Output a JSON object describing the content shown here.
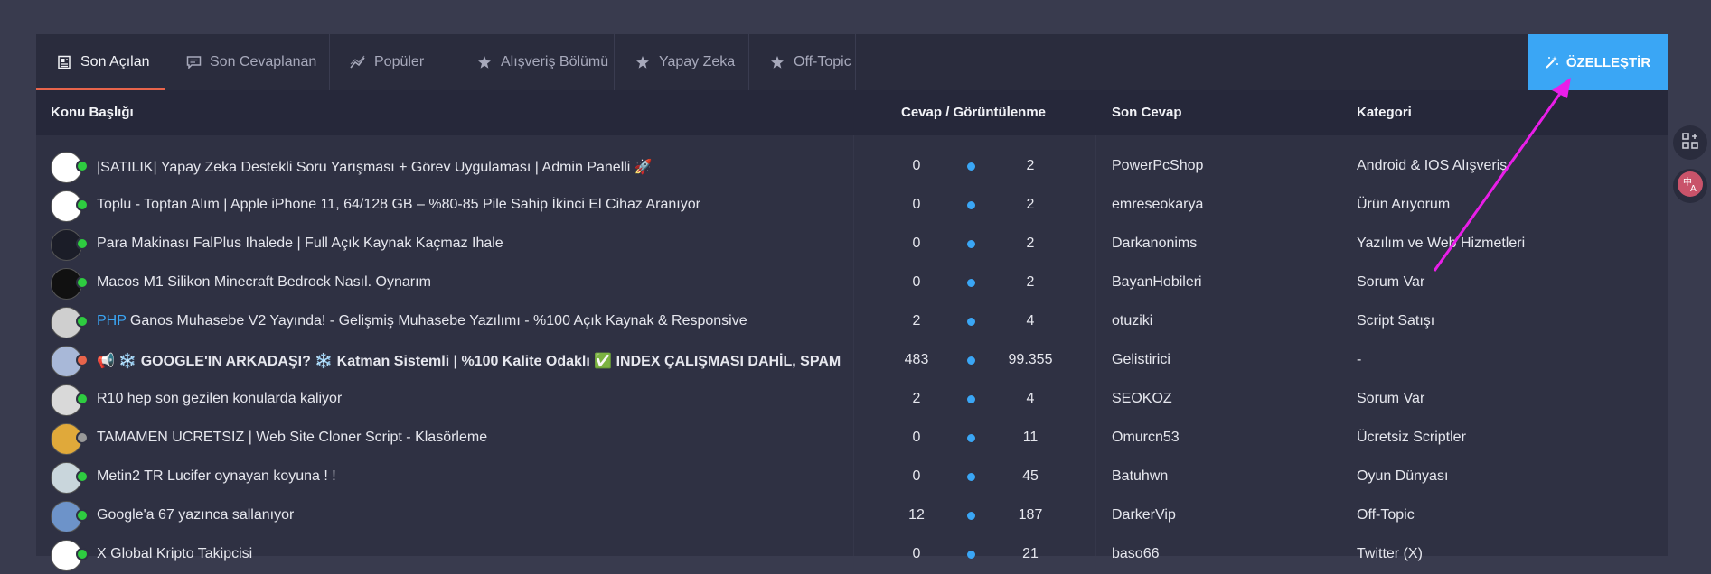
{
  "tabs": [
    {
      "label": "Son Açılan",
      "icon": "document-icon",
      "active": true
    },
    {
      "label": "Son Cevaplanan",
      "icon": "chat-icon",
      "active": false
    },
    {
      "label": "Popüler",
      "icon": "trend-icon",
      "active": false
    },
    {
      "label": "Alışveriş Bölümü",
      "icon": "star-icon",
      "active": false
    },
    {
      "label": "Yapay Zeka",
      "icon": "star-icon",
      "active": false
    },
    {
      "label": "Off-Topic",
      "icon": "star-icon",
      "active": false
    }
  ],
  "customize": {
    "label": "ÖZELLEŞTİR",
    "icon": "magic-wand-icon"
  },
  "headers": {
    "topic": "Konu Başlığı",
    "replies_views": "Cevap / Görüntülenme",
    "last_reply": "Son Cevap",
    "category": "Kategori"
  },
  "colors": {
    "accent": "#3aa6f5",
    "active_tab": "#e8644b",
    "online": "#2ecc40",
    "offline": "#999999",
    "hot": "#e8644b",
    "annotation": "#e91ee8"
  },
  "rows": [
    {
      "title": "|SATILIK| Yapay Zeka Destekli Soru Yarışması + Görev Uygulaması | Admin Panelli 🚀",
      "prefix": "",
      "replies": "0",
      "views": "2",
      "user": "PowerPcShop",
      "category": "Android & IOS Alışveriş",
      "status": "online",
      "bold": false
    },
    {
      "title": "Toplu - Toptan Alım | Apple iPhone 11, 64/128 GB – %80-85 Pile Sahip İkinci El Cihaz Aranıyor",
      "prefix": "",
      "replies": "0",
      "views": "2",
      "user": "emreseokarya",
      "category": "Ürün Arıyorum",
      "status": "online",
      "bold": false
    },
    {
      "title": "Para Makinası FalPlus İhalede | Full Açık Kaynak Kaçmaz İhale",
      "prefix": "",
      "replies": "0",
      "views": "2",
      "user": "Darkanonims",
      "category": "Yazılım ve Web Hizmetleri",
      "status": "online",
      "bold": false
    },
    {
      "title": "Macos M1 Silikon Minecraft Bedrock Nasıl. Oynarım",
      "prefix": "",
      "replies": "0",
      "views": "2",
      "user": "BayanHobileri",
      "category": "Sorum Var",
      "status": "online",
      "bold": false
    },
    {
      "title": "Ganos Muhasebe V2 Yayında! - Gelişmiş Muhasebe Yazılımı - %100 Açık Kaynak & Responsive",
      "prefix": "PHP",
      "replies": "2",
      "views": "4",
      "user": "otuziki",
      "category": "Script Satışı",
      "status": "online",
      "bold": false
    },
    {
      "title": "📢 ❄️ GOOGLE'IN ARKADAŞI? ❄️ Katman Sistemli | %100 Kalite Odaklı ✅ INDEX ÇALIŞMASI DAHİL, SPAM",
      "prefix": "",
      "replies": "483",
      "views": "99.355",
      "user": "Gelistirici",
      "category": "-",
      "status": "hot",
      "bold": true
    },
    {
      "title": "R10 hep son gezilen konularda kaliyor",
      "prefix": "",
      "replies": "2",
      "views": "4",
      "user": "SEOKOZ",
      "category": "Sorum Var",
      "status": "online",
      "bold": false
    },
    {
      "title": "TAMAMEN ÜCRETSİZ | Web Site Cloner Script - Klasörleme",
      "prefix": "",
      "replies": "0",
      "views": "11",
      "user": "Omurcn53",
      "category": "Ücretsiz Scriptler",
      "status": "offline",
      "bold": false
    },
    {
      "title": "Metin2 TR Lucifer oynayan koyuna ! !",
      "prefix": "",
      "replies": "0",
      "views": "45",
      "user": "Batuhwn",
      "category": "Oyun Dünyası",
      "status": "online",
      "bold": false
    },
    {
      "title": "Google'a 67 yazınca sallanıyor",
      "prefix": "",
      "replies": "12",
      "views": "187",
      "user": "DarkerVip",
      "category": "Off-Topic",
      "status": "online",
      "bold": false
    },
    {
      "title": "X Global Kripto Takipcisi",
      "prefix": "",
      "replies": "0",
      "views": "21",
      "user": "baso66",
      "category": "Twitter (X)",
      "status": "online",
      "bold": false
    }
  ],
  "side_buttons": [
    {
      "icon": "apps-grid-icon"
    },
    {
      "icon": "translate-icon"
    }
  ]
}
